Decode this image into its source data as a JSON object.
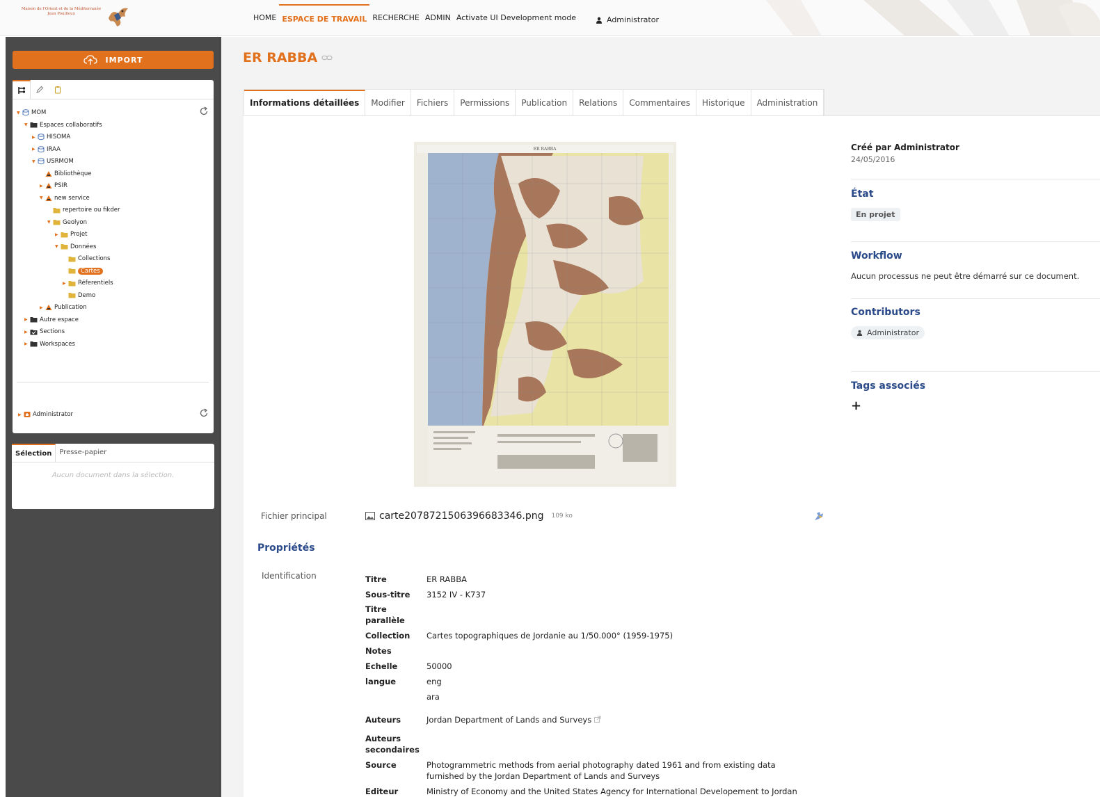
{
  "brand": {
    "logo_text": "Maison de l'Orient et de la Méditerranée Jean Pouilloux"
  },
  "nav": {
    "items": [
      "HOME",
      "ESPACE DE TRAVAIL",
      "RECHERCHE",
      "ADMIN",
      "Activate UI Development mode"
    ],
    "active": "ESPACE DE TRAVAIL",
    "user": "Administrator"
  },
  "sidebar": {
    "import_label": "IMPORT",
    "tree": [
      {
        "label": "MOM",
        "level": 0,
        "icon": "database-icon",
        "expanded": true
      },
      {
        "label": "Espaces collaboratifs",
        "level": 1,
        "icon": "folder-icon",
        "expanded": true
      },
      {
        "label": "HISOMA",
        "level": 2,
        "icon": "database-icon",
        "expanded": false
      },
      {
        "label": "IRAA",
        "level": 2,
        "icon": "database-icon",
        "expanded": false
      },
      {
        "label": "USRMOM",
        "level": 2,
        "icon": "database-icon",
        "expanded": true
      },
      {
        "label": "Bibliothèque",
        "level": 3,
        "icon": "workspace-icon",
        "expanded": null
      },
      {
        "label": "PSIR",
        "level": 3,
        "icon": "workspace-icon",
        "expanded": false
      },
      {
        "label": "new service",
        "level": 3,
        "icon": "workspace-icon",
        "expanded": true
      },
      {
        "label": "repertoire ou fikder",
        "level": 4,
        "icon": "folder-icon",
        "expanded": null
      },
      {
        "label": "Geolyon",
        "level": 4,
        "icon": "folder-icon",
        "expanded": true
      },
      {
        "label": "Projet",
        "level": 5,
        "icon": "folder-icon",
        "expanded": false
      },
      {
        "label": "Données",
        "level": 5,
        "icon": "folder-icon",
        "expanded": true
      },
      {
        "label": "Collections",
        "level": 6,
        "icon": "folder-icon",
        "expanded": null
      },
      {
        "label": "Cartes",
        "level": 6,
        "icon": "folder-icon",
        "expanded": null,
        "selected": true
      },
      {
        "label": "Réferentiels",
        "level": 6,
        "icon": "folder-icon",
        "expanded": false
      },
      {
        "label": "Demo",
        "level": 6,
        "icon": "folder-icon",
        "expanded": null
      },
      {
        "label": "Publication",
        "level": 3,
        "icon": "workspace-icon",
        "expanded": false
      },
      {
        "label": "Autre espace",
        "level": 1,
        "icon": "folder-icon",
        "expanded": false
      },
      {
        "label": "Sections",
        "level": 1,
        "icon": "sections-icon",
        "expanded": false
      },
      {
        "label": "Workspaces",
        "level": 1,
        "icon": "folder-icon",
        "expanded": false
      }
    ],
    "user_tree": {
      "label": "Administrator"
    },
    "selection_tabs": [
      "Sélection",
      "Presse-papier"
    ],
    "selection_empty": "Aucun document dans la sélection."
  },
  "document": {
    "title": "ER RABBA",
    "tabs": [
      "Informations détaillées",
      "Modifier",
      "Fichiers",
      "Permissions",
      "Publication",
      "Relations",
      "Commentaires",
      "Historique",
      "Administration"
    ],
    "active_tab": "Informations détaillées",
    "main_file_label": "Fichier principal",
    "main_file_name": "carte2078721506396683346.png",
    "main_file_size": "109 ko",
    "properties_heading": "Propriétés",
    "identification_label": "Identification",
    "properties": [
      {
        "key": "Titre",
        "value": "ER RABBA"
      },
      {
        "key": "Sous-titre",
        "value": "3152 IV - K737"
      },
      {
        "key": "Titre parallèle",
        "value": ""
      },
      {
        "key": "Collection",
        "value": "Cartes topographiques de Jordanie au 1/50.000° (1959-1975)"
      },
      {
        "key": "Notes",
        "value": ""
      },
      {
        "key": "Echelle",
        "value": "50000"
      },
      {
        "key": "langue",
        "value": "eng"
      },
      {
        "key": "",
        "value": "ara"
      },
      {
        "key": "Auteurs",
        "value": "Jordan Department of Lands and Surveys"
      },
      {
        "key": "Auteurs secondaires",
        "value": ""
      },
      {
        "key": "Source",
        "value": "Photogrammetric methods from aerial photography dated 1961 and from existing data furnished by the Jordan Department of Lands and Surveys"
      },
      {
        "key": "Editeur",
        "value": "Ministry of Economy and the United States Agency for International Developement to Jordan"
      }
    ]
  },
  "side": {
    "created_by": "Créé par Administrator",
    "created_date": "24/05/2016",
    "state_heading": "État",
    "state_value": "En projet",
    "workflow_heading": "Workflow",
    "workflow_text": "Aucun processus ne peut être démarré sur ce document.",
    "contributors_heading": "Contributors",
    "contributor": "Administrator",
    "tags_heading": "Tags associés",
    "add_tag": "+"
  },
  "map": {
    "header_title": "ER RABBA"
  },
  "colors": {
    "accent": "#e2711d",
    "heading_blue": "#2a4a8a",
    "sidebar_bg": "#4a4a4a",
    "map_terrain": "#a8765a",
    "map_sea": "#9fb3cf",
    "map_plain": "#ece7a0"
  }
}
